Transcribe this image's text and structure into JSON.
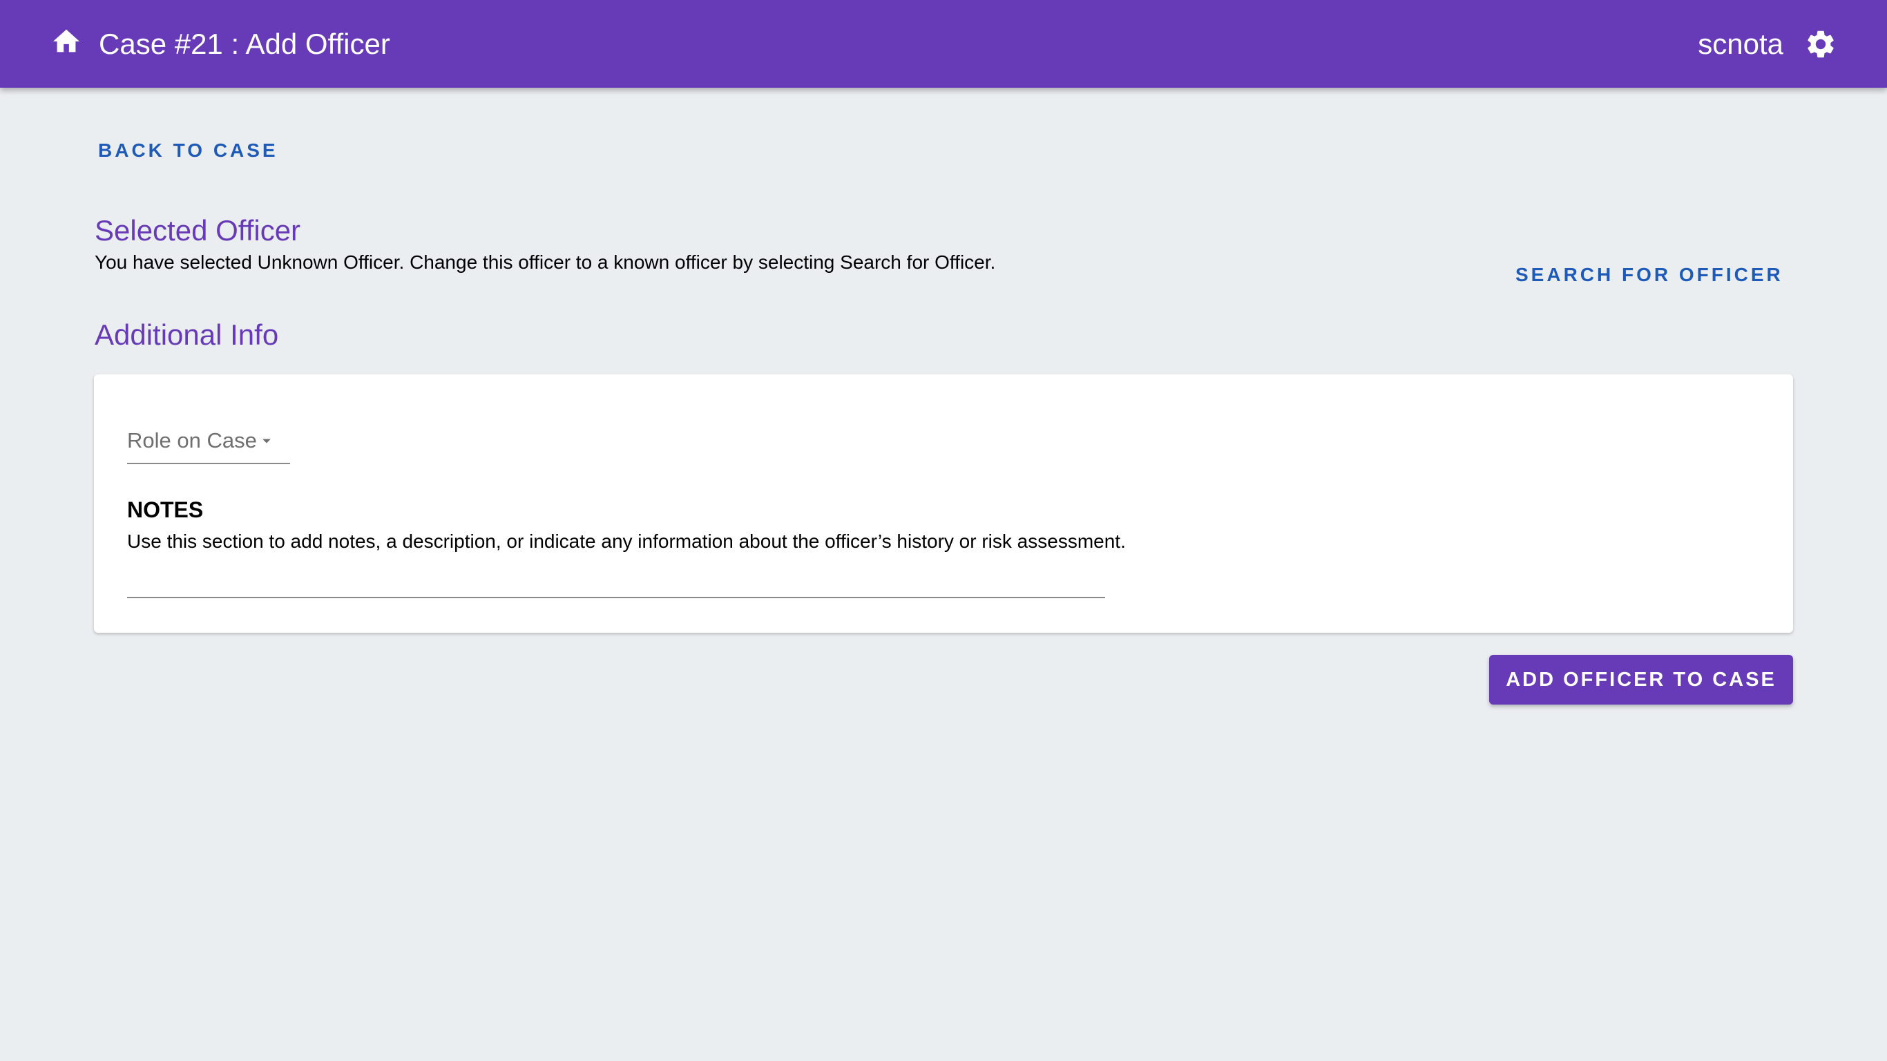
{
  "header": {
    "title": "Case #21 : Add Officer",
    "username": "scnota",
    "home_icon": "home-icon",
    "settings_icon": "gear-icon",
    "background_color": "#673AB7"
  },
  "nav": {
    "back_label": "BACK TO CASE"
  },
  "selected_officer": {
    "heading": "Selected Officer",
    "description": "You have selected Unknown Officer. Change this officer to a known officer by selecting Search for Officer.",
    "search_label": "SEARCH FOR OFFICER"
  },
  "additional_info": {
    "heading": "Additional Info",
    "role_select": {
      "label": "Role on Case",
      "value": ""
    },
    "notes": {
      "title": "NOTES",
      "description": "Use this section to add notes, a description, or indicate any information about the officer’s history or risk assessment.",
      "value": ""
    }
  },
  "actions": {
    "submit_label": "ADD OFFICER TO CASE"
  },
  "colors": {
    "primary": "#673AB7",
    "link": "#1E5BB8",
    "background": "#EBEEF1"
  }
}
